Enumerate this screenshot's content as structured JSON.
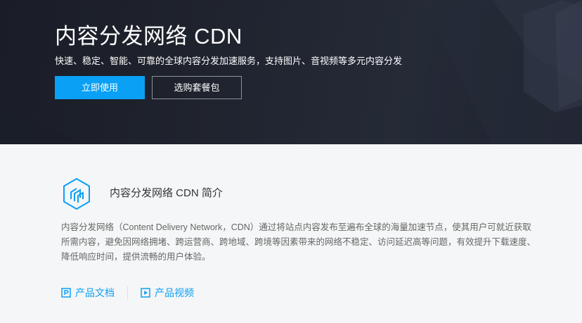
{
  "hero": {
    "title": "内容分发网络 CDN",
    "subtitle": "快速、稳定、智能、可靠的全球内容分发加速服务，支持图片、音视频等多元内容分发",
    "primary_button": "立即使用",
    "secondary_button": "选购套餐包"
  },
  "intro": {
    "icon": "cdn-product-icon",
    "title": "内容分发网络 CDN 简介",
    "description": "内容分发网络（Content Delivery Network，CDN）通过将站点内容发布至遍布全球的海量加速节点，使其用户可就近获取所需内容，避免因网络拥堵、跨运营商、跨地域、跨境等因素带来的网络不稳定、访问延迟高等问题，有效提升下载速度、降低响应时间，提供流畅的用户体验。",
    "links": [
      {
        "label": "产品文档",
        "icon": "document-icon"
      },
      {
        "label": "产品视频",
        "icon": "play-icon"
      }
    ]
  },
  "colors": {
    "accent": "#0aa0f5",
    "hero_bg": "#1f2330",
    "page_bg": "#f5f6f7"
  }
}
